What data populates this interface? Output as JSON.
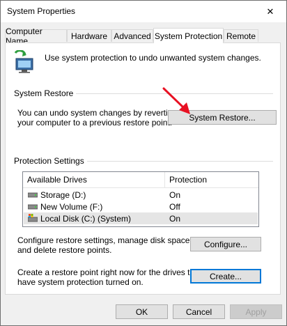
{
  "window": {
    "title": "System Properties",
    "close_symbol": "✕"
  },
  "tabs": [
    {
      "label": "Computer Name",
      "active": false
    },
    {
      "label": "Hardware",
      "active": false
    },
    {
      "label": "Advanced",
      "active": false
    },
    {
      "label": "System Protection",
      "active": true
    },
    {
      "label": "Remote",
      "active": false
    }
  ],
  "intro_text": "Use system protection to undo unwanted system changes.",
  "system_restore": {
    "group_label": "System Restore",
    "description_line1": "You can undo system changes by reverting",
    "description_line2": "your computer to a previous restore point.",
    "button_label": "System Restore..."
  },
  "protection_settings": {
    "group_label": "Protection Settings",
    "columns": [
      "Available Drives",
      "Protection"
    ],
    "drives": [
      {
        "name": "Storage (D:)",
        "protection": "On",
        "icon": "hard-drive-icon",
        "selected": false
      },
      {
        "name": "New Volume (F:)",
        "protection": "Off",
        "icon": "hard-drive-icon",
        "selected": false
      },
      {
        "name": "Local Disk (C:) (System)",
        "protection": "On",
        "icon": "system-drive-icon",
        "selected": true
      }
    ],
    "configure_line1": "Configure restore settings, manage disk space,",
    "configure_line2": "and delete restore points.",
    "configure_button": "Configure...",
    "create_line1": "Create a restore point right now for the drives that",
    "create_line2": "have system protection turned on.",
    "create_button": "Create..."
  },
  "footer": {
    "ok": "OK",
    "cancel": "Cancel",
    "apply": "Apply"
  },
  "colors": {
    "accent": "#0078d7",
    "arrow": "#e81123"
  }
}
